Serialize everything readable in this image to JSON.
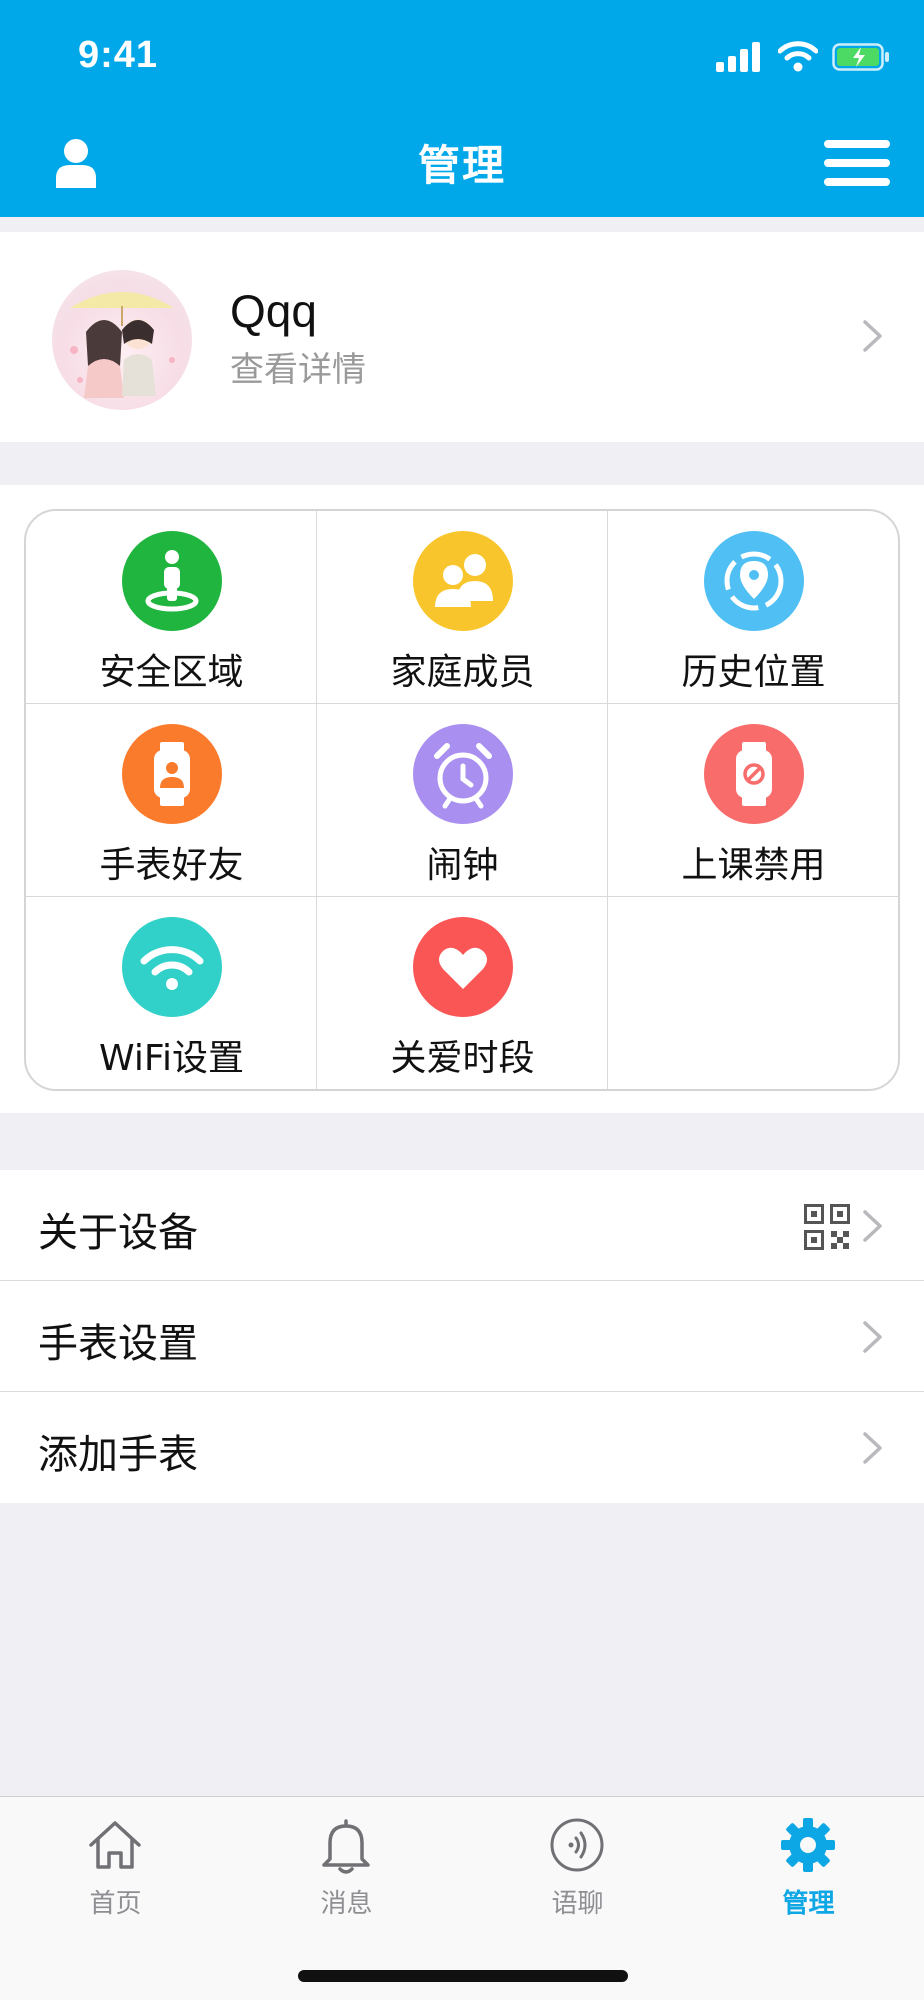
{
  "status_bar": {
    "time": "9:41"
  },
  "nav": {
    "title": "管理",
    "left_icon": "user-icon",
    "right_icon": "menu-icon"
  },
  "profile": {
    "name": "Qqq",
    "subtitle": "查看详情"
  },
  "grid": [
    {
      "label": "安全区域",
      "icon": "safe-zone-icon",
      "color": "#1fb53e"
    },
    {
      "label": "家庭成员",
      "icon": "family-icon",
      "color": "#f8c62c"
    },
    {
      "label": "历史位置",
      "icon": "location-history-icon",
      "color": "#4fbff4"
    },
    {
      "label": "手表好友",
      "icon": "watch-friend-icon",
      "color": "#fb7b2c"
    },
    {
      "label": "闹钟",
      "icon": "alarm-clock-icon",
      "color": "#a98ff0"
    },
    {
      "label": "上课禁用",
      "icon": "class-disable-icon",
      "color": "#f86c6c"
    },
    {
      "label": "WiFi设置",
      "icon": "wifi-settings-icon",
      "color": "#31d1c9"
    },
    {
      "label": "关爱时段",
      "icon": "heart-icon",
      "color": "#fb5656"
    }
  ],
  "list": [
    {
      "label": "关于设备",
      "has_qr": true
    },
    {
      "label": "手表设置",
      "has_qr": false
    },
    {
      "label": "添加手表",
      "has_qr": false
    }
  ],
  "tabbar": [
    {
      "label": "首页",
      "icon": "home-icon",
      "active": false
    },
    {
      "label": "消息",
      "icon": "bell-icon",
      "active": false
    },
    {
      "label": "语聊",
      "icon": "voice-chat-icon",
      "active": false
    },
    {
      "label": "管理",
      "icon": "gear-icon",
      "active": true
    }
  ],
  "colors": {
    "primary": "#00a8ea",
    "active_tab": "#0ea7e6"
  }
}
